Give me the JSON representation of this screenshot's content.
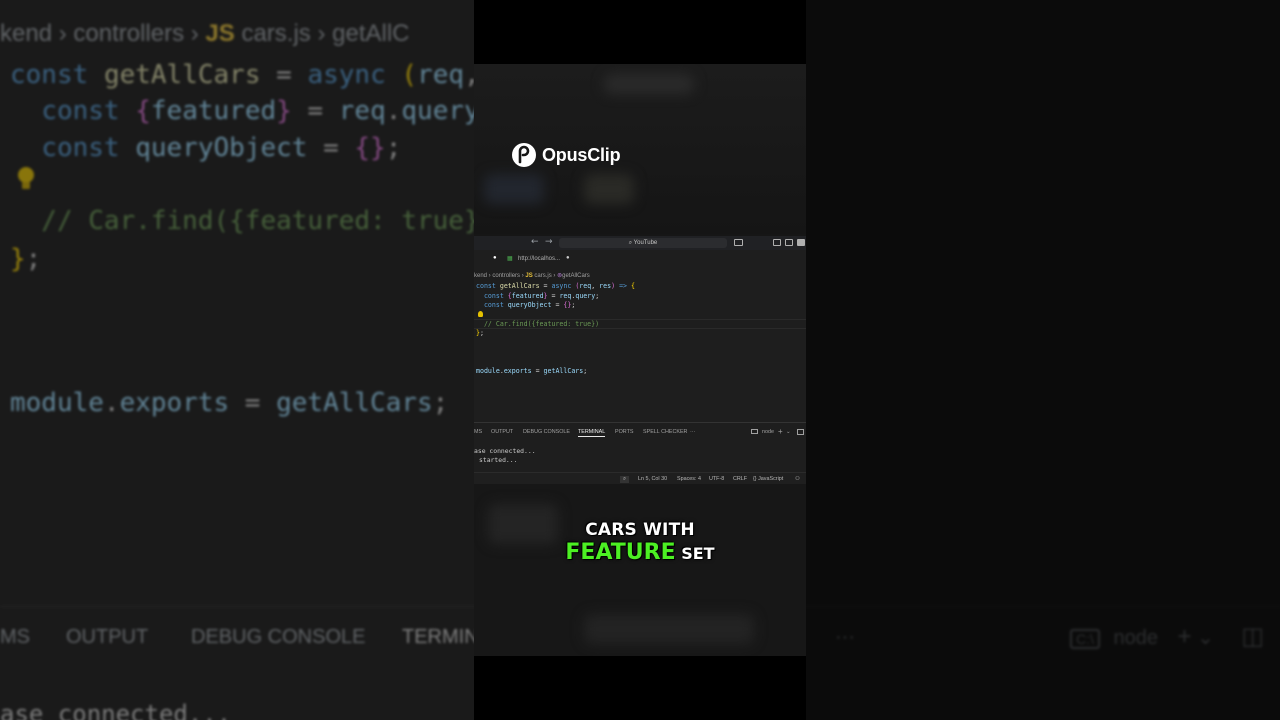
{
  "background": {
    "breadcrumb": [
      "kend",
      "controllers",
      "JS",
      "cars.js",
      "getAllC"
    ],
    "code_lines": [
      "const getAllCars = async (req, r",
      "  const {featured} = req.query;",
      "  const queryObject = {};",
      "",
      "  // Car.find({featured: true})",
      "};",
      "",
      "",
      "module.exports = getAllCars;"
    ],
    "panel_tabs": [
      "MS",
      "OUTPUT",
      "DEBUG CONSOLE",
      "TERMIN"
    ],
    "panel_more": "···",
    "panel_shell": "node",
    "terminal_line": "ase connected..."
  },
  "logo": {
    "name": "OpusClip"
  },
  "browser": {
    "address": "YouTube",
    "back_icon": "←",
    "forward_icon": "→"
  },
  "editor": {
    "tab_label": "http://localhos...",
    "breadcrumb": {
      "folder1": "kend",
      "folder2": "controllers",
      "lang": "JS",
      "file": "cars.js",
      "symbol": "getAllCars"
    }
  },
  "panel": {
    "tabs": [
      "MS",
      "OUTPUT",
      "DEBUG CONSOLE",
      "TERMINAL",
      "PORTS",
      "SPELL CHECKER",
      "···"
    ],
    "active_tab": "TERMINAL",
    "shell": "node",
    "terminal_lines": [
      "ase connected...",
      "started..."
    ]
  },
  "status_bar": {
    "position": "Ln 5, Col 30",
    "spaces": "Spaces: 4",
    "encoding": "UTF-8",
    "eol": "CRLF",
    "language": "{} JavaScript"
  },
  "caption": {
    "line1": "CARS WITH",
    "highlight": "FEATURE",
    "rest": "SET",
    "highlight_color": "#4cf023"
  }
}
